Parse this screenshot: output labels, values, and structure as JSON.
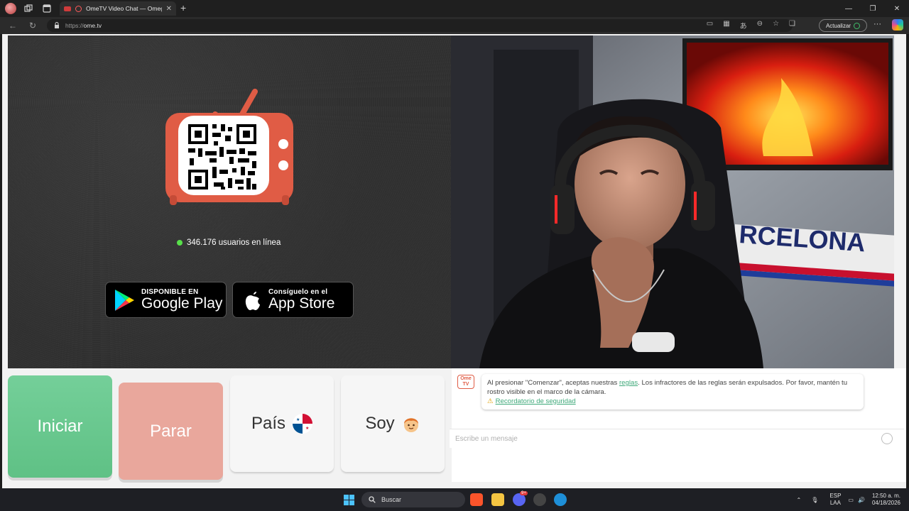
{
  "browser": {
    "tab_title": "OmeTV Video Chat — Omeg",
    "url_scheme": "https://",
    "url_host": "ome.tv",
    "update_label": "Actualizar"
  },
  "app": {
    "online_count": "346.176 usuarios en línea",
    "google_play": {
      "small": "DISPONIBLE EN",
      "big": "Google Play"
    },
    "app_store": {
      "small": "Consíguelo en el",
      "big": "App Store"
    },
    "buttons": {
      "start": "Iniciar",
      "stop": "Parar",
      "country": "País",
      "gender": "Soy"
    },
    "chat": {
      "logo_text": "Ome TV",
      "notice_prefix": "Al presionar \"Comenzar\", aceptas nuestras ",
      "rules_link": "reglas",
      "notice_suffix": ". Los infractores de las reglas serán expulsados. Por favor, mantén tu rostro visible en el marco de la cámara.",
      "safety_link": "Recordatorio de seguridad",
      "input_placeholder": "Escribe un mensaje"
    },
    "webcam_banner_text": "RCELONA"
  },
  "taskbar": {
    "search_placeholder": "Buscar",
    "lang_top": "ESP",
    "lang_bottom": "LAA",
    "time": "12:50 a. m.",
    "date": "04/18/2026",
    "discord_badge": "9+"
  },
  "colors": {
    "start_green": "#6bc98f",
    "stop_red": "#e9a79c",
    "brand_orange": "#e05c45",
    "online_green": "#58e04a"
  }
}
